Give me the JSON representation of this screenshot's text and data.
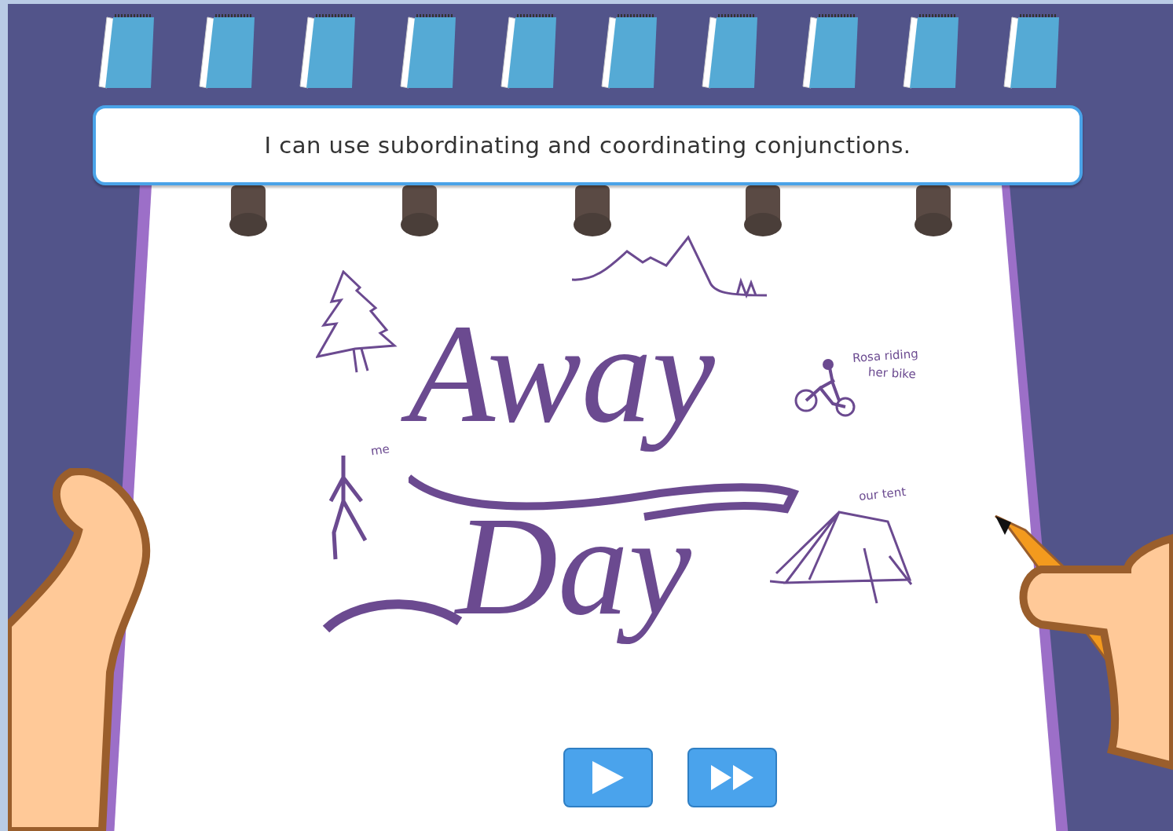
{
  "objective": "I can use subordinating and coordinating conjunctions.",
  "notepad": {
    "title_lines": [
      "Away",
      "Day"
    ],
    "labels": [
      {
        "kind": "me",
        "text": "me"
      },
      {
        "kind": "rosa",
        "text": "Rosa riding"
      },
      {
        "kind": "rosa-line2",
        "text": "her bike"
      },
      {
        "kind": "tent",
        "text": "our tent"
      }
    ]
  },
  "controls": [
    {
      "kind": "play"
    },
    {
      "kind": "skip"
    }
  ]
}
